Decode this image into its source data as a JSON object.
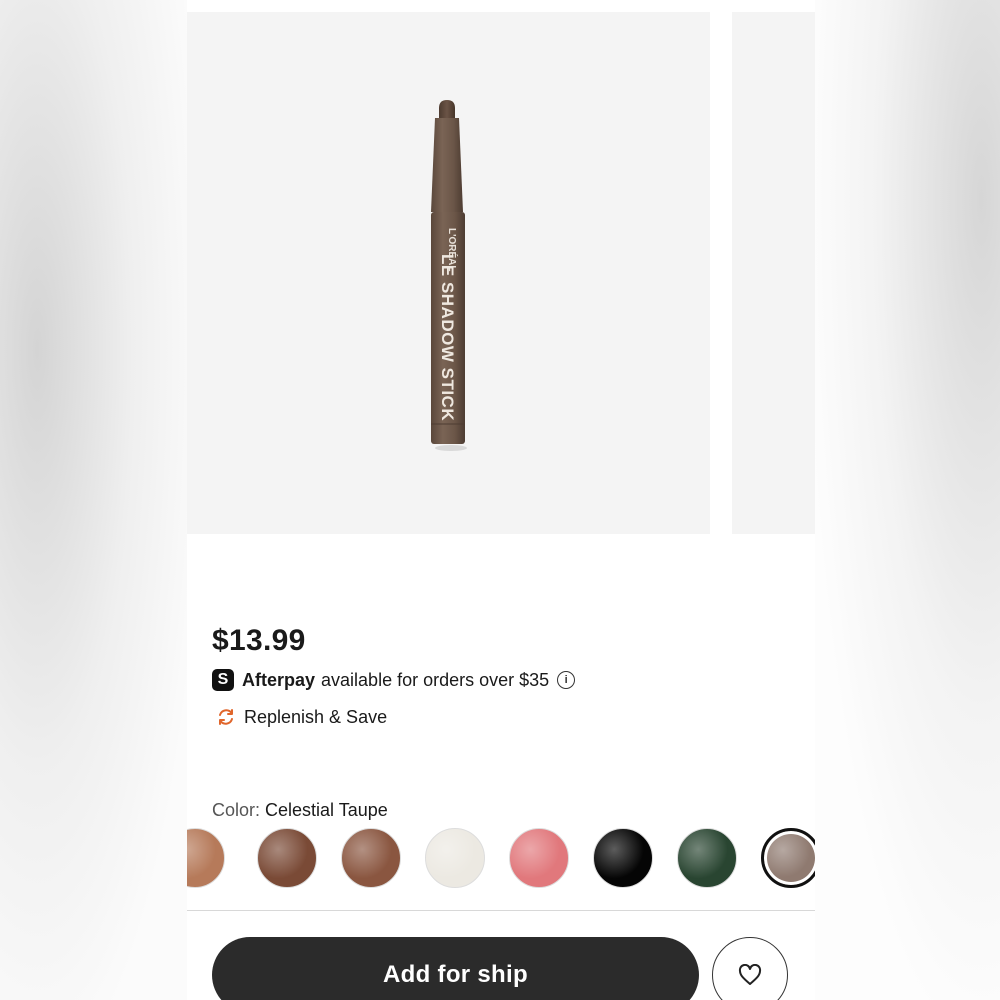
{
  "product": {
    "image_icon": "eyeshadow-stick",
    "stick_brand": "L'ORÉAL",
    "stick_name": "LE SHADOW STICK",
    "price": "$13.99"
  },
  "afterpay": {
    "icon": "afterpay-logo",
    "logo_glyph": "S",
    "brand": "Afterpay",
    "text": "available for orders over $35",
    "info_icon": "info-icon"
  },
  "replenish": {
    "icon": "refresh-icon",
    "label": "Replenish & Save"
  },
  "color": {
    "label": "Color:",
    "selected": "Celestial Taupe",
    "swatches": [
      {
        "color": "#b67a5a",
        "selected": false
      },
      {
        "color": "#7a4a36",
        "selected": false
      },
      {
        "color": "#8a5640",
        "selected": false
      },
      {
        "color": "#ece9e2",
        "selected": false
      },
      {
        "color": "#e1787c",
        "selected": false
      },
      {
        "color": "#050505",
        "selected": false
      },
      {
        "color": "#294531",
        "selected": false
      },
      {
        "color": "#8f7a70",
        "selected": true
      }
    ]
  },
  "actions": {
    "add_label": "Add for ship",
    "favorite_icon": "heart-icon"
  },
  "colors": {
    "stick_body": "#6f5a4c",
    "button_dark": "#2b2b2b",
    "replenish_accent": "#e0662c"
  }
}
